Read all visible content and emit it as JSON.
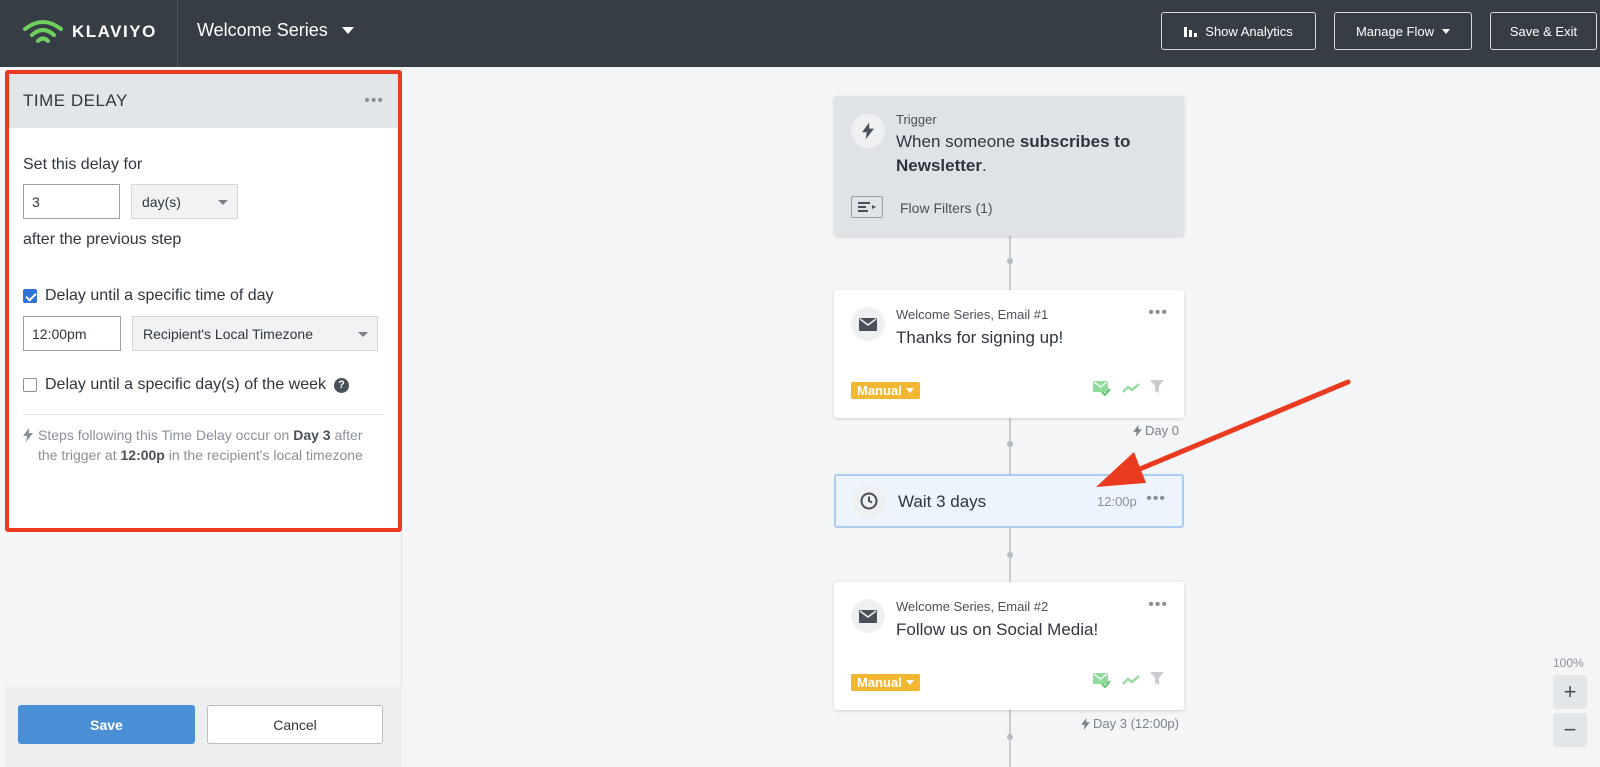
{
  "header": {
    "logo_text": "KLAVIYO",
    "flow_name": "Welcome Series",
    "show_analytics": "Show Analytics",
    "manage_flow": "Manage Flow",
    "save_exit": "Save & Exit"
  },
  "panel": {
    "title": "TIME DELAY",
    "set_delay_label": "Set this delay for",
    "delay_value": "3",
    "delay_unit": "day(s)",
    "after_label": "after the previous step",
    "time_of_day_label": "Delay until a specific time of day",
    "time_of_day_checked": true,
    "time_value": "12:00pm",
    "timezone": "Recipient's Local Timezone",
    "day_of_week_label": "Delay until a specific day(s) of the week",
    "day_of_week_checked": false,
    "note_prefix": "Steps following this Time Delay occur on",
    "note_day": "Day 3",
    "note_mid": "after the trigger at",
    "note_time": "12:00p",
    "note_suffix": "in the recipient's local timezone",
    "save_label": "Save",
    "cancel_label": "Cancel"
  },
  "flow": {
    "trigger": {
      "label": "Trigger",
      "text_pre": "When someone",
      "text_bold": "subscribes to Newsletter",
      "text_post": ".",
      "filters": "Flow Filters (1)"
    },
    "email1": {
      "label": "Welcome Series, Email #1",
      "subject": "Thanks for signing up!",
      "badge": "Manual",
      "day": "Day 0"
    },
    "wait": {
      "label": "Wait 3 days",
      "time": "12:00p"
    },
    "email2": {
      "label": "Welcome Series, Email #2",
      "subject": "Follow us on Social Media!",
      "badge": "Manual",
      "day": "Day 3 (12:00p)"
    }
  },
  "zoom": {
    "level": "100%",
    "plus": "+",
    "minus": "−"
  },
  "colors": {
    "topbar": "#373d45",
    "highlight_border": "#ea3a20",
    "primary_button": "#4a8fd6",
    "badge": "#f2b731",
    "arrow": "#ea3a20"
  }
}
